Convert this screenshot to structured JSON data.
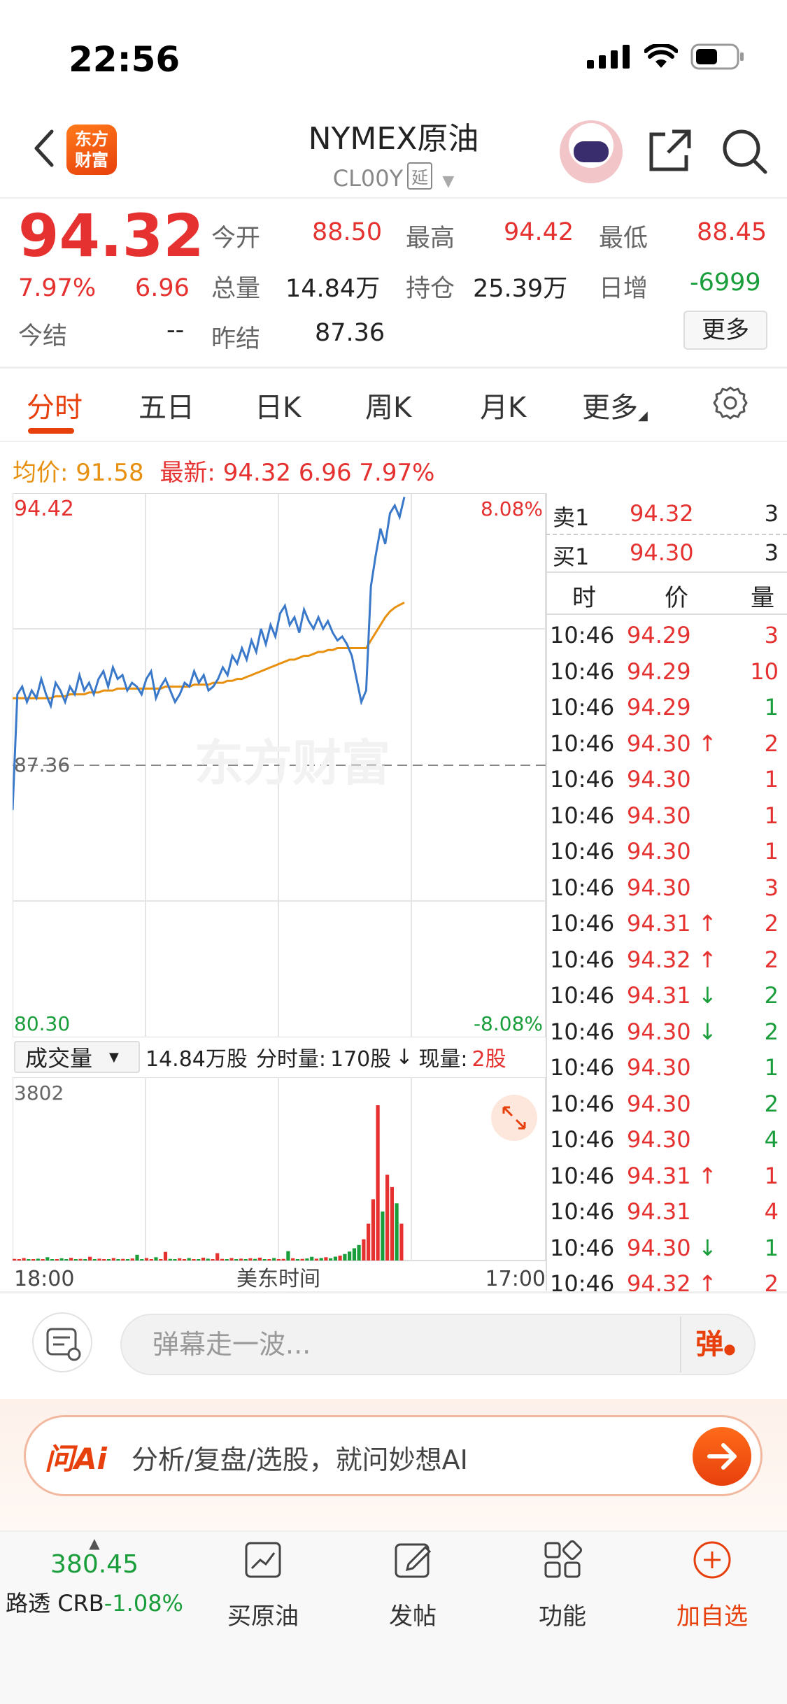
{
  "status_bar": {
    "time": "22:56"
  },
  "nav": {
    "logo_text": [
      "东方",
      "财富"
    ],
    "title": "NYMEX原油",
    "code": "CL00Y",
    "delay_tag": "延"
  },
  "quote": {
    "price": "94.32",
    "change_pct": "7.97%",
    "change": "6.96",
    "today_settle_label": "今结",
    "today_settle": "--",
    "open_label": "今开",
    "open": "88.50",
    "high_label": "最高",
    "high": "94.42",
    "low_label": "最低",
    "low": "88.45",
    "volume_label": "总量",
    "volume": "14.84万",
    "oi_label": "持仓",
    "oi": "25.39万",
    "daily_inc_label": "日增",
    "daily_inc": "-6999",
    "prev_settle_label": "昨结",
    "prev_settle": "87.36",
    "more_label": "更多"
  },
  "tabs": [
    "分时",
    "五日",
    "日K",
    "周K",
    "月K",
    "更多"
  ],
  "active_tab": "分时",
  "avg_line": {
    "avg_label": "均价:",
    "avg": "91.58",
    "latest_label": "最新:",
    "latest": "94.32",
    "latest_change": "6.96",
    "latest_pct": "7.97%"
  },
  "chart_labels": {
    "top_price": "94.42",
    "top_pct": "8.08%",
    "mid_price": "87.36",
    "bottom_price": "80.30",
    "bottom_pct": "-8.08%",
    "watermark": "东方财富",
    "vol_max": "3802",
    "x_start": "18:00",
    "x_mid": "美东时间",
    "x_end": "17:00"
  },
  "volume_header": {
    "select": "成交量",
    "total": "14.84万股",
    "tick_label": "分时量:",
    "tick_value": "170股",
    "current_label": "现量:",
    "current_value": "2股"
  },
  "chart_data": {
    "type": "line",
    "ylim": [
      80.3,
      94.42
    ],
    "prev_settle": 87.36,
    "series": [],
    "price": [
      86.2,
      89.2,
      89.4,
      89.0,
      89.3,
      89.1,
      89.6,
      89.2,
      88.9,
      89.5,
      89.3,
      89.0,
      89.4,
      89.2,
      89.7,
      89.3,
      89.5,
      89.2,
      89.6,
      89.8,
      89.4,
      89.9,
      89.6,
      89.7,
      89.3,
      89.5,
      89.4,
      89.2,
      89.6,
      89.8,
      89.1,
      89.4,
      89.6,
      89.3,
      89.0,
      89.2,
      89.5,
      89.4,
      89.8,
      89.5,
      89.7,
      89.3,
      89.4,
      89.6,
      89.9,
      89.7,
      90.2,
      90.0,
      90.4,
      90.1,
      90.6,
      90.3,
      90.9,
      90.5,
      91.0,
      90.7,
      91.3,
      91.5,
      91.0,
      91.2,
      90.8,
      91.4,
      91.1,
      90.9,
      91.2,
      90.9,
      91.1,
      90.8,
      90.6,
      90.7,
      90.5,
      90.2,
      89.6,
      89.0,
      89.3,
      92.0,
      92.8,
      93.5,
      93.1,
      93.9,
      94.1,
      93.8,
      94.32
    ],
    "avg": [
      89.1,
      89.1,
      89.1,
      89.1,
      89.1,
      89.1,
      89.1,
      89.1,
      89.1,
      89.15,
      89.15,
      89.15,
      89.2,
      89.2,
      89.2,
      89.2,
      89.25,
      89.25,
      89.25,
      89.3,
      89.3,
      89.3,
      89.35,
      89.35,
      89.35,
      89.35,
      89.35,
      89.35,
      89.35,
      89.35,
      89.35,
      89.35,
      89.4,
      89.4,
      89.4,
      89.4,
      89.4,
      89.4,
      89.45,
      89.45,
      89.45,
      89.45,
      89.5,
      89.5,
      89.5,
      89.55,
      89.55,
      89.6,
      89.6,
      89.65,
      89.7,
      89.75,
      89.8,
      89.85,
      89.9,
      89.95,
      90.0,
      90.05,
      90.1,
      90.1,
      90.15,
      90.2,
      90.2,
      90.25,
      90.3,
      90.3,
      90.35,
      90.35,
      90.4,
      90.4,
      90.4,
      90.4,
      90.4,
      90.4,
      90.4,
      90.6,
      90.8,
      91.0,
      91.2,
      91.35,
      91.45,
      91.52,
      91.58
    ],
    "volumes": [
      40,
      20,
      60,
      30,
      15,
      45,
      25,
      80,
      35,
      20,
      55,
      30,
      65,
      20,
      40,
      25,
      90,
      30,
      45,
      20,
      35,
      60,
      25,
      40,
      20,
      50,
      140,
      35,
      60,
      25,
      80,
      30,
      210,
      40,
      25,
      55,
      30,
      60,
      35,
      20,
      70,
      45,
      30,
      180,
      40,
      25,
      60,
      35,
      45,
      30,
      55,
      40,
      70,
      30,
      25,
      60,
      35,
      40,
      230,
      55,
      35,
      40,
      50,
      90,
      45,
      60,
      80,
      55,
      95,
      120,
      160,
      220,
      300,
      380,
      520,
      900,
      1500,
      3802,
      1200,
      2100,
      1800,
      1400,
      900
    ],
    "vol_ylim": [
      0,
      3802
    ]
  },
  "order_book": {
    "sell1_label": "卖1",
    "sell1_price": "94.32",
    "sell1_qty": "3",
    "buy1_label": "买1",
    "buy1_price": "94.30",
    "buy1_qty": "3",
    "col_time": "时",
    "col_price": "价",
    "col_qty": "量",
    "ticks": [
      {
        "t": "10:46",
        "p": "94.29",
        "q": "3",
        "arrow": "",
        "pc": "red",
        "qc": "red"
      },
      {
        "t": "10:46",
        "p": "94.29",
        "q": "10",
        "arrow": "",
        "pc": "red",
        "qc": "red"
      },
      {
        "t": "10:46",
        "p": "94.29",
        "q": "1",
        "arrow": "",
        "pc": "red",
        "qc": "green"
      },
      {
        "t": "10:46",
        "p": "94.30",
        "q": "2",
        "arrow": "↑",
        "pc": "red",
        "qc": "red"
      },
      {
        "t": "10:46",
        "p": "94.30",
        "q": "1",
        "arrow": "",
        "pc": "red",
        "qc": "red"
      },
      {
        "t": "10:46",
        "p": "94.30",
        "q": "1",
        "arrow": "",
        "pc": "red",
        "qc": "red"
      },
      {
        "t": "10:46",
        "p": "94.30",
        "q": "1",
        "arrow": "",
        "pc": "red",
        "qc": "red"
      },
      {
        "t": "10:46",
        "p": "94.30",
        "q": "3",
        "arrow": "",
        "pc": "red",
        "qc": "red"
      },
      {
        "t": "10:46",
        "p": "94.31",
        "q": "2",
        "arrow": "↑",
        "pc": "red",
        "qc": "red"
      },
      {
        "t": "10:46",
        "p": "94.32",
        "q": "2",
        "arrow": "↑",
        "pc": "red",
        "qc": "red"
      },
      {
        "t": "10:46",
        "p": "94.31",
        "q": "2",
        "arrow": "↓",
        "pc": "red",
        "qc": "green"
      },
      {
        "t": "10:46",
        "p": "94.30",
        "q": "2",
        "arrow": "↓",
        "pc": "red",
        "qc": "green"
      },
      {
        "t": "10:46",
        "p": "94.30",
        "q": "1",
        "arrow": "",
        "pc": "red",
        "qc": "green"
      },
      {
        "t": "10:46",
        "p": "94.30",
        "q": "2",
        "arrow": "",
        "pc": "red",
        "qc": "green"
      },
      {
        "t": "10:46",
        "p": "94.30",
        "q": "4",
        "arrow": "",
        "pc": "red",
        "qc": "green"
      },
      {
        "t": "10:46",
        "p": "94.31",
        "q": "1",
        "arrow": "↑",
        "pc": "red",
        "qc": "red"
      },
      {
        "t": "10:46",
        "p": "94.31",
        "q": "4",
        "arrow": "",
        "pc": "red",
        "qc": "red"
      },
      {
        "t": "10:46",
        "p": "94.30",
        "q": "1",
        "arrow": "↓",
        "pc": "red",
        "qc": "green"
      },
      {
        "t": "10:46",
        "p": "94.32",
        "q": "2",
        "arrow": "↑",
        "pc": "red",
        "qc": "red"
      }
    ]
  },
  "comment": {
    "placeholder": "弹幕走一波...",
    "danmu_label": "弹"
  },
  "ai": {
    "logo": "问Ai",
    "text": "分析/复盘/选股，就问妙想AI"
  },
  "bottom_bar": {
    "index_value": "380.45",
    "index_name": "路透 CRB",
    "index_pct": "-1.08%",
    "buy": "买原油",
    "post": "发帖",
    "func": "功能",
    "watch": "加自选"
  },
  "colors": {
    "red": "#e5312f",
    "green": "#1a9e3c",
    "orange": "#e8900f",
    "accent": "#e8400c",
    "price_line": "#3a78c9"
  }
}
